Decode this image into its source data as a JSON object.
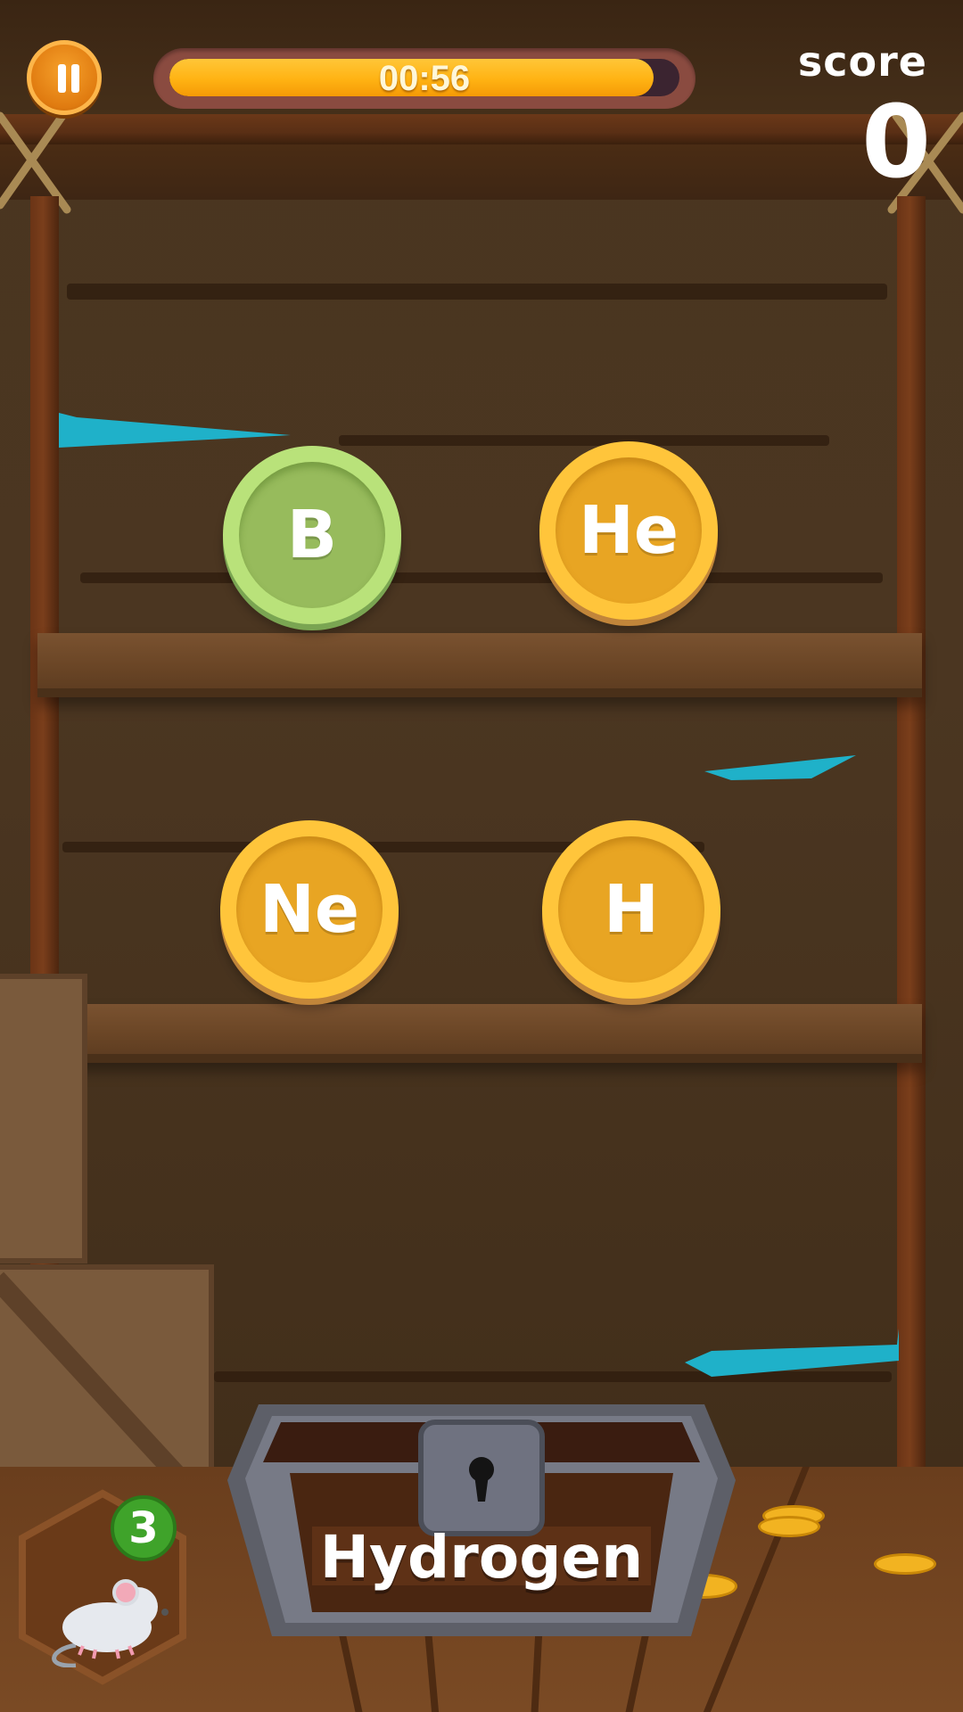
{
  "hud": {
    "timer_text": "00:56",
    "timer_progress": 0.95,
    "score_label": "score",
    "score_value": "0",
    "pause_icon": "pause-icon"
  },
  "coins": [
    {
      "symbol": "B",
      "color": "green"
    },
    {
      "symbol": "He",
      "color": "gold"
    },
    {
      "symbol": "Ne",
      "color": "gold"
    },
    {
      "symbol": "H",
      "color": "gold"
    }
  ],
  "chest": {
    "label": "Hydrogen",
    "icon": "keyhole-icon"
  },
  "lives": {
    "count": "3",
    "icon": "mouse-icon"
  },
  "colors": {
    "gold": "#ffc53b",
    "green": "#b9e27a",
    "timer_fill": "#ffb313",
    "lives_badge": "#3fa32a"
  }
}
